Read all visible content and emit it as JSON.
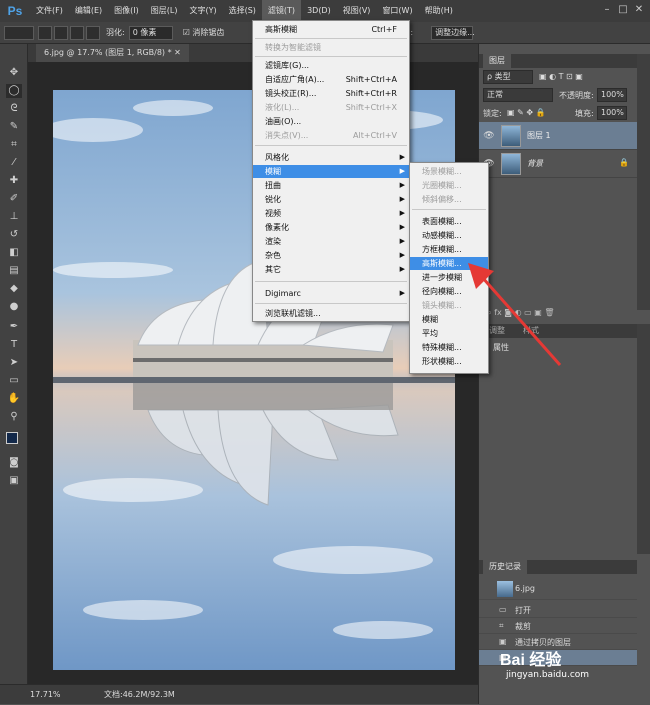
{
  "app": {
    "logo": "Ps"
  },
  "menubar": {
    "items": [
      "文件(F)",
      "编辑(E)",
      "图像(I)",
      "图层(L)",
      "文字(Y)",
      "选择(S)",
      "滤镜(T)",
      "3D(D)",
      "视图(V)",
      "窗口(W)",
      "帮助(H)"
    ],
    "active_index": 6
  },
  "options": {
    "feather_label": "羽化:",
    "feather_value": "0 像素",
    "antialias_label": "消除锯齿",
    "height_label": "高度:",
    "refine_label": "调整边缘..."
  },
  "document": {
    "tab_title": "6.jpg @ 17.7% (图层 1, RGB/8) *",
    "zoom": "17.71%",
    "doc_size": "文档:46.2M/92.3M"
  },
  "filter_menu": {
    "items": [
      {
        "label": "高斯模糊",
        "shortcut": "Ctrl+F",
        "disabled": false
      },
      {
        "label": "转换为智能滤镜",
        "shortcut": "",
        "disabled": true
      },
      {
        "label": "滤镜库(G)...",
        "shortcut": "",
        "disabled": false
      },
      {
        "label": "自适应广角(A)...",
        "shortcut": "Shift+Ctrl+A",
        "disabled": false
      },
      {
        "label": "镜头校正(R)...",
        "shortcut": "Shift+Ctrl+R",
        "disabled": false
      },
      {
        "label": "液化(L)...",
        "shortcut": "Shift+Ctrl+X",
        "disabled": true
      },
      {
        "label": "油画(O)...",
        "shortcut": "",
        "disabled": false
      },
      {
        "label": "消失点(V)...",
        "shortcut": "Alt+Ctrl+V",
        "disabled": true
      },
      {
        "label": "风格化",
        "submenu": true
      },
      {
        "label": "模糊",
        "submenu": true,
        "highlighted": true
      },
      {
        "label": "扭曲",
        "submenu": true
      },
      {
        "label": "锐化",
        "submenu": true
      },
      {
        "label": "视频",
        "submenu": true
      },
      {
        "label": "像素化",
        "submenu": true
      },
      {
        "label": "渲染",
        "submenu": true
      },
      {
        "label": "杂色",
        "submenu": true
      },
      {
        "label": "其它",
        "submenu": true
      },
      {
        "label": "Digimarc",
        "submenu": true
      },
      {
        "label": "浏览联机滤镜...",
        "shortcut": ""
      }
    ]
  },
  "blur_submenu": {
    "items": [
      {
        "label": "场景模糊...",
        "disabled": true
      },
      {
        "label": "光圈模糊...",
        "disabled": true
      },
      {
        "label": "倾斜偏移...",
        "disabled": true
      },
      {
        "label": "表面模糊...",
        "disabled": false
      },
      {
        "label": "动感模糊...",
        "disabled": false
      },
      {
        "label": "方框模糊...",
        "disabled": false
      },
      {
        "label": "高斯模糊...",
        "disabled": false,
        "highlighted": true
      },
      {
        "label": "进一步模糊",
        "disabled": false
      },
      {
        "label": "径向模糊...",
        "disabled": false
      },
      {
        "label": "镜头模糊...",
        "disabled": true
      },
      {
        "label": "模糊",
        "disabled": false
      },
      {
        "label": "平均",
        "disabled": false
      },
      {
        "label": "特殊模糊...",
        "disabled": false
      },
      {
        "label": "形状模糊...",
        "disabled": false
      }
    ]
  },
  "layers_panel": {
    "tab": "图层",
    "kind_label": "ρ 类型",
    "blend_mode": "正常",
    "opacity_label": "不透明度:",
    "opacity_value": "100%",
    "lock_label": "锁定:",
    "fill_label": "填充:",
    "fill_value": "100%",
    "layers": [
      "图层 1",
      "背景"
    ]
  },
  "properties_panel": {
    "tab": "属性"
  },
  "history_panel": {
    "tab": "历史记录",
    "snapshot": "6.jpg",
    "steps": [
      "打开",
      "裁剪",
      "通过拷贝的图层",
      ""
    ]
  },
  "watermark": {
    "text": "Bai 经验",
    "url": "jingyan.baidu.com"
  },
  "colors": {
    "highlight": "#3e8ee6",
    "arrow": "#e53935"
  }
}
